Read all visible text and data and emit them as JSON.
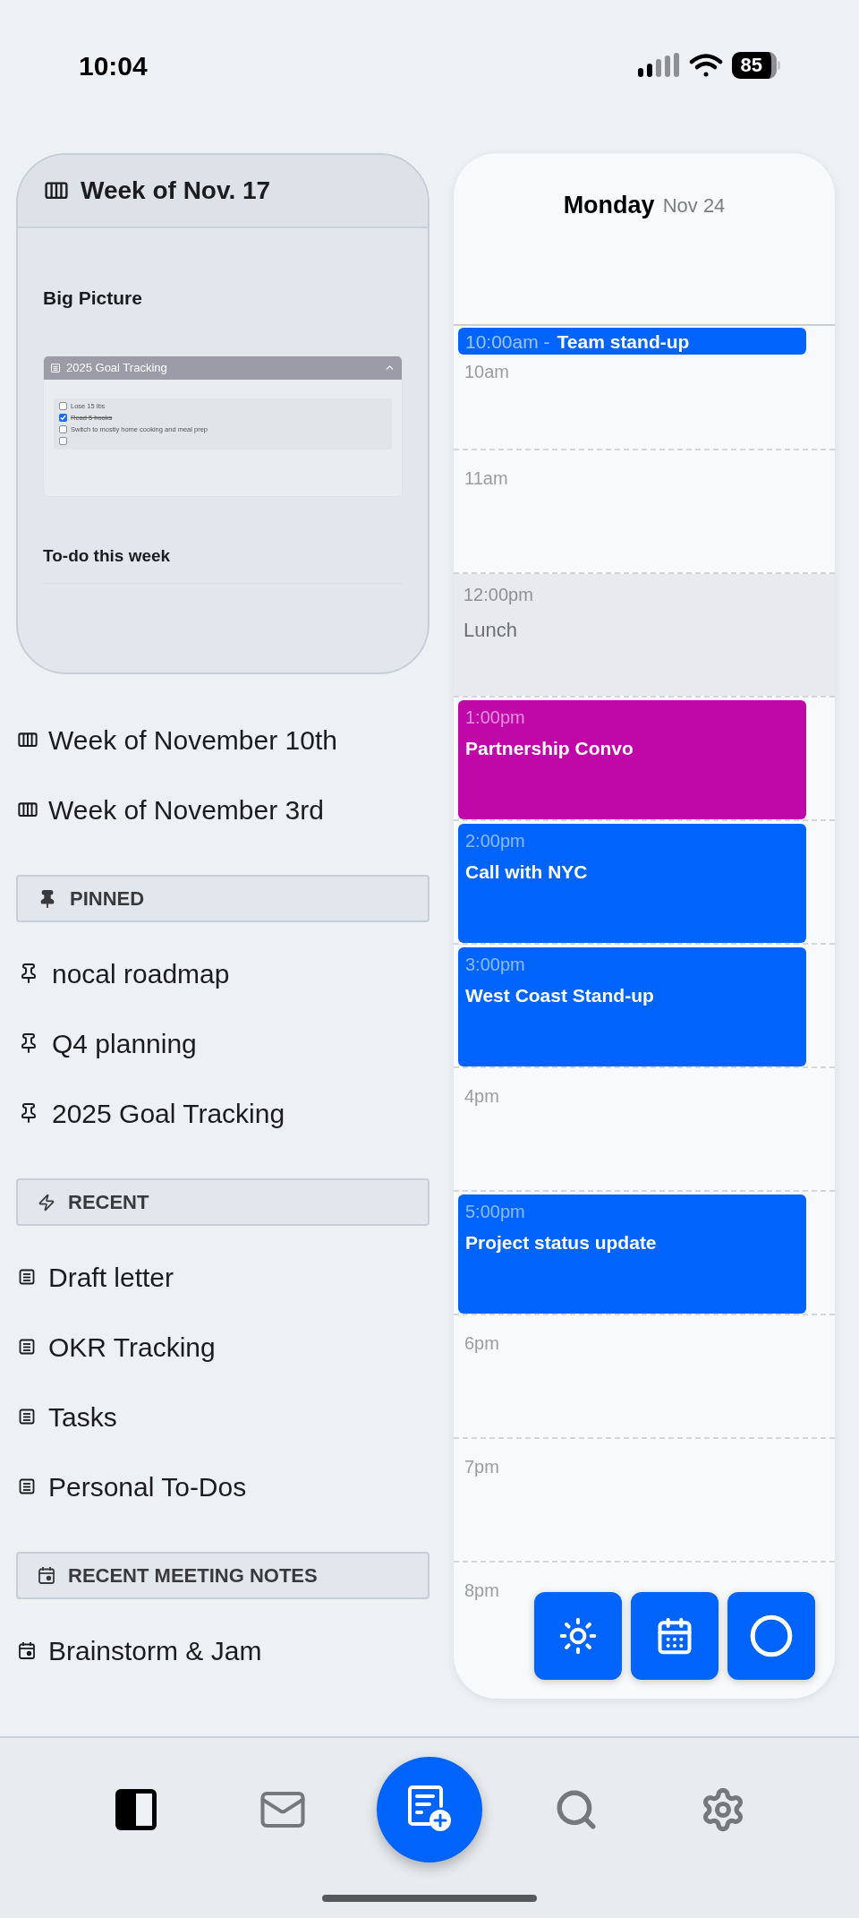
{
  "status_bar": {
    "time": "10:04",
    "battery": "85"
  },
  "week_card": {
    "title": "Week of Nov. 17",
    "big_picture_heading": "Big Picture",
    "embed": {
      "title": "2025 Goal Tracking",
      "expanded": true,
      "tasks": [
        {
          "text": "Lose 15 lbs",
          "checked": false
        },
        {
          "text": "Read 5 books",
          "checked": true
        },
        {
          "text": "Switch to mostly home cooking and meal prep",
          "checked": false
        },
        {
          "checked": false
        }
      ]
    },
    "todo_heading": "To-do this week"
  },
  "sidebar": {
    "weeks": [
      "Week of November 10th",
      "Week of November 3rd"
    ],
    "sections": [
      {
        "kind": "pinned",
        "title": "PINNED",
        "items": [
          "nocal roadmap",
          "Q4 planning",
          "2025 Goal Tracking"
        ]
      },
      {
        "kind": "recent",
        "title": "RECENT",
        "items": [
          "Draft letter",
          "OKR Tracking",
          "Tasks",
          "Personal To-Dos"
        ]
      },
      {
        "kind": "meetings",
        "title": "RECENT MEETING NOTES",
        "items": [
          "Brainstorm & Jam"
        ]
      }
    ]
  },
  "calendar": {
    "day": "Monday",
    "date": "Nov 24",
    "hours": [
      {
        "label": "10am",
        "event": {
          "kind": "compact",
          "time": "10:00am -",
          "title": "Team stand-up",
          "color": "#0064fa"
        }
      },
      {
        "label": "11am"
      },
      {
        "event": {
          "kind": "muted",
          "time": "12:00pm",
          "title": "Lunch"
        }
      },
      {
        "event": {
          "kind": "block",
          "time": "1:00pm",
          "title": "Partnership Convo",
          "color": "#c008a9"
        }
      },
      {
        "event": {
          "kind": "block",
          "time": "2:00pm",
          "title": "Call with NYC",
          "color": "#0064fa"
        }
      },
      {
        "event": {
          "kind": "block",
          "time": "3:00pm",
          "title": "West Coast Stand-up",
          "color": "#0064fa"
        }
      },
      {
        "label": "4pm"
      },
      {
        "event": {
          "kind": "block",
          "time": "5:00pm",
          "title": "Project status update",
          "color": "#0064fa"
        }
      },
      {
        "label": "6pm"
      },
      {
        "label": "7pm"
      },
      {
        "label": "8pm"
      }
    ],
    "actions": [
      {
        "kind": "sun"
      },
      {
        "kind": "calendar"
      },
      {
        "kind": "circle"
      }
    ]
  },
  "tab_bar": [
    {
      "kind": "sidebar",
      "selected": true
    },
    {
      "kind": "mail",
      "selected": false
    },
    {
      "kind": "compose",
      "selected": false
    },
    {
      "kind": "search",
      "selected": false
    },
    {
      "kind": "settings",
      "selected": false
    }
  ]
}
